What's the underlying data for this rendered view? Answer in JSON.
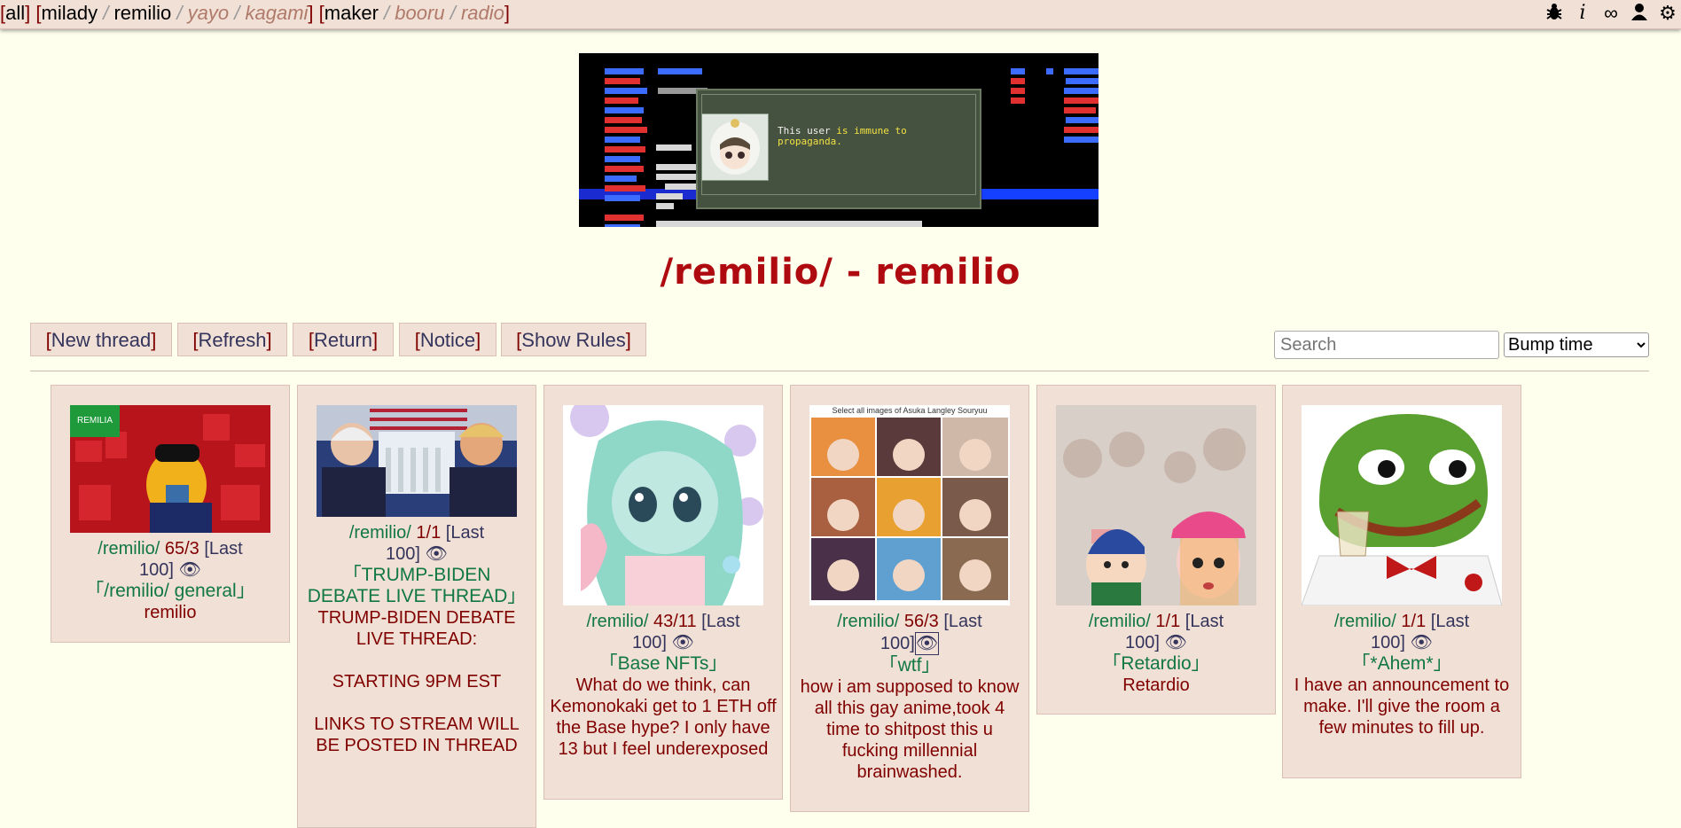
{
  "nav": {
    "groups": [
      {
        "items": [
          {
            "label": "all",
            "dim": false
          }
        ]
      },
      {
        "items": [
          {
            "label": "milady",
            "dim": false
          },
          {
            "label": "remilio",
            "dim": false
          },
          {
            "label": "yayo",
            "dim": true
          },
          {
            "label": "kagami",
            "dim": true
          }
        ]
      },
      {
        "items": [
          {
            "label": "maker",
            "dim": false
          },
          {
            "label": "booru",
            "dim": true
          },
          {
            "label": "radio",
            "dim": true
          }
        ]
      }
    ],
    "icons": [
      "bug-icon",
      "info-icon",
      "infinity-icon",
      "user-icon",
      "gear-icon"
    ]
  },
  "banner": {
    "dialog_text_line1_a": "This user ",
    "dialog_text_line1_b": "is immune to",
    "dialog_text_line2": "propaganda."
  },
  "page_title": "/remilio/ - remilio",
  "toolbar": {
    "new_thread": "New thread",
    "refresh": "Refresh",
    "return": "Return",
    "notice": "Notice",
    "show_rules": "Show Rules"
  },
  "search": {
    "placeholder": "Search"
  },
  "sort": {
    "selected": "Bump time"
  },
  "threads": [
    {
      "board": "/remilio/",
      "counts": "65/3",
      "last": "Last",
      "last_num": "100",
      "subject": "「/remilio/ general」",
      "body": "remilio"
    },
    {
      "board": "/remilio/",
      "counts": "1/1",
      "last": "Last",
      "last_num": "100",
      "subject": "「TRUMP-BIDEN DEBATE LIVE THREAD」",
      "body": "TRUMP-BIDEN DEBATE LIVE THREAD:\n\nSTARTING 9PM EST\n\nLINKS TO STREAM WILL BE POSTED IN THREAD"
    },
    {
      "board": "/remilio/",
      "counts": "43/11",
      "last": "Last",
      "last_num": "100",
      "subject": "「Base NFTs」",
      "body": "What do we think, can Kemonokaki get to 1 ETH off the Base hype? I only have 13 but I feel underexposed"
    },
    {
      "board": "/remilio/",
      "counts": "56/3",
      "last": "Last",
      "last_num": "100",
      "subject": "「wtf」",
      "body": "how i am supposed to know all this gay anime,took 4 time to shitpost this u fucking millennial brainwashed."
    },
    {
      "board": "/remilio/",
      "counts": "1/1",
      "last": "Last",
      "last_num": "100",
      "subject": "「Retardio」",
      "body": "Retardio"
    },
    {
      "board": "/remilio/",
      "counts": "1/1",
      "last": "Last",
      "last_num": "100",
      "subject": "「*Ahem*」",
      "body": "I have an announcement to make. I'll give the room a few minutes to fill up."
    }
  ],
  "captcha_text": "Select all images of Asuka Langley Souryuu",
  "colors": {
    "background": "#ffffee",
    "card": "#f0e0d6",
    "title": "#af0a0f",
    "subject": "#117743",
    "body": "#800000",
    "link": "#34345c"
  }
}
